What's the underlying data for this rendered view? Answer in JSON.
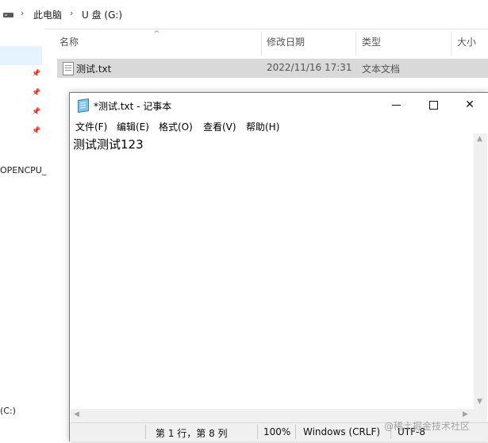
{
  "explorer": {
    "breadcrumb": [
      "此电脑",
      "U 盘 (G:)"
    ],
    "sidebar_items": [
      "OPENCPU_",
      "(C:)"
    ],
    "columns": [
      "名称",
      "修改日期",
      "类型",
      "大小"
    ],
    "files": [
      {
        "name": "测试.txt",
        "modified": "2022/11/16 17:31",
        "type": "文本文档"
      }
    ]
  },
  "notepad": {
    "title": "*测试.txt - 记事本",
    "menu": [
      "文件(F)",
      "编辑(E)",
      "格式(O)",
      "查看(V)",
      "帮助(H)"
    ],
    "content": "测试测试123",
    "status": {
      "position": "第 1 行，第 8 列",
      "zoom": "100%",
      "line_ending": "Windows (CRLF)",
      "encoding": "UTF-8"
    },
    "window_buttons": {
      "close": "✕"
    }
  },
  "watermark": "@稀土掘金技术社区"
}
